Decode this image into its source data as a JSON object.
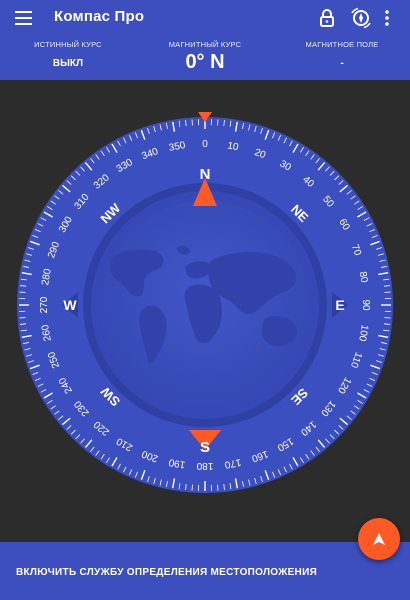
{
  "app": {
    "title": "Компас Про"
  },
  "header": {
    "true_course": {
      "label": "ИСТИННЫЙ КУРС",
      "value": "ВЫКЛ"
    },
    "magnetic_course": {
      "label": "МАГНИТНЫЙ КУРС",
      "value": "0° N"
    },
    "magnetic_field": {
      "label": "МАГНИТНОЕ ПОЛЕ",
      "value": "-"
    }
  },
  "compass": {
    "heading_degrees": 0,
    "degree_labels": [
      "0",
      "10",
      "20",
      "30",
      "40",
      "50",
      "60",
      "70",
      "80",
      "90",
      "100",
      "110",
      "120",
      "130",
      "140",
      "150",
      "160",
      "170",
      "180",
      "190",
      "200",
      "210",
      "220",
      "230",
      "240",
      "250",
      "260",
      "270",
      "280",
      "290",
      "300",
      "310",
      "320",
      "330",
      "340",
      "350"
    ],
    "cardinals": {
      "n": "N",
      "s": "S",
      "e": "E",
      "w": "W"
    },
    "intercardinals": {
      "ne": "NE",
      "se": "SE",
      "sw": "SW",
      "nw": "NW"
    }
  },
  "bottom": {
    "location_service_text": "ВКЛЮЧИТЬ СЛУЖБУ ОПРЕДЕЛЕНИЯ МЕСТОПОЛОЖЕНИЯ"
  },
  "colors": {
    "accent_blue": "#3d4fbf",
    "dial_blue": "#3c4fc1",
    "orange": "#ff5a24",
    "background": "#2c2c2c"
  },
  "icons": {
    "menu": "menu-icon",
    "lock": "lock-icon",
    "calibrate": "compass-calibrate-icon",
    "more": "more-vertical-icon",
    "fab": "navigation-arrow-icon"
  }
}
